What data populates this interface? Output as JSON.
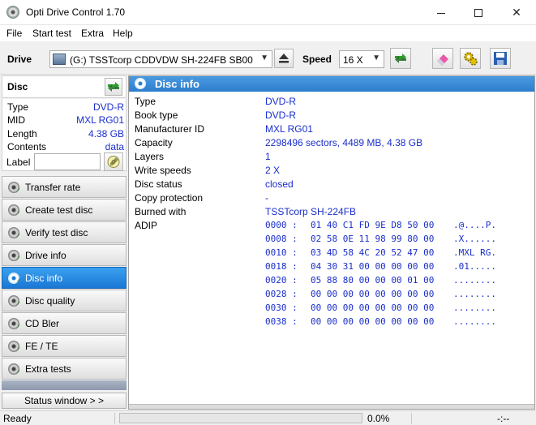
{
  "window": {
    "title": "Opti Drive Control 1.70"
  },
  "menu": [
    "File",
    "Start test",
    "Extra",
    "Help"
  ],
  "toolbar": {
    "drive_label": "Drive",
    "drive_value": "(G:)   TSSTcorp CDDVDW SH-224FB SB00",
    "speed_label": "Speed",
    "speed_value": "16 X"
  },
  "disc_panel": {
    "title": "Disc",
    "props": [
      {
        "key": "Type",
        "value": "DVD-R"
      },
      {
        "key": "MID",
        "value": "MXL RG01"
      },
      {
        "key": "Length",
        "value": "4.38 GB"
      },
      {
        "key": "Contents",
        "value": "data"
      }
    ],
    "label_key": "Label",
    "label_value": ""
  },
  "nav": [
    {
      "label": "Transfer rate",
      "active": false
    },
    {
      "label": "Create test disc",
      "active": false
    },
    {
      "label": "Verify test disc",
      "active": false
    },
    {
      "label": "Drive info",
      "active": false
    },
    {
      "label": "Disc info",
      "active": true
    },
    {
      "label": "Disc quality",
      "active": false
    },
    {
      "label": "CD Bler",
      "active": false
    },
    {
      "label": "FE / TE",
      "active": false
    },
    {
      "label": "Extra tests",
      "active": false
    }
  ],
  "status_window_button": "Status window > >",
  "disc_info": {
    "title": "Disc info",
    "rows": [
      {
        "key": "Type",
        "value": "DVD-R"
      },
      {
        "key": "Book type",
        "value": "DVD-R"
      },
      {
        "key": "Manufacturer ID",
        "value": "MXL RG01"
      },
      {
        "key": "Capacity",
        "value": "2298496 sectors, 4489 MB, 4.38 GB"
      },
      {
        "key": "Layers",
        "value": "1"
      },
      {
        "key": "Write speeds",
        "value": "2 X"
      },
      {
        "key": "Disc status",
        "value": "closed"
      },
      {
        "key": "Copy protection",
        "value": "-"
      },
      {
        "key": "Burned with",
        "value": "TSSTcorp SH-224FB"
      },
      {
        "key": "ADIP",
        "value": ""
      }
    ],
    "adip": [
      {
        "offset": "0000 :",
        "hex": "01 40 C1 FD 9E D8 50 00",
        "ascii": ".@....P."
      },
      {
        "offset": "0008 :",
        "hex": "02 58 0E 11 98 99 80 00",
        "ascii": ".X......"
      },
      {
        "offset": "0010 :",
        "hex": "03 4D 58 4C 20 52 47 00",
        "ascii": ".MXL RG."
      },
      {
        "offset": "0018 :",
        "hex": "04 30 31 00 00 00 00 00",
        "ascii": ".01....."
      },
      {
        "offset": "0020 :",
        "hex": "05 88 80 00 00 00 01 00",
        "ascii": "........"
      },
      {
        "offset": "0028 :",
        "hex": "00 00 00 00 00 00 00 00",
        "ascii": "........"
      },
      {
        "offset": "0030 :",
        "hex": "00 00 00 00 00 00 00 00",
        "ascii": "........"
      },
      {
        "offset": "0038 :",
        "hex": "00 00 00 00 00 00 00 00",
        "ascii": "........"
      }
    ]
  },
  "statusbar": {
    "status": "Ready",
    "progress_fraction": 0,
    "percent": "0.0%",
    "time": "-:--"
  },
  "colors": {
    "value_text": "#1a2ecc",
    "active_nav": "#1a78d4",
    "header": "#3a8bd8"
  }
}
